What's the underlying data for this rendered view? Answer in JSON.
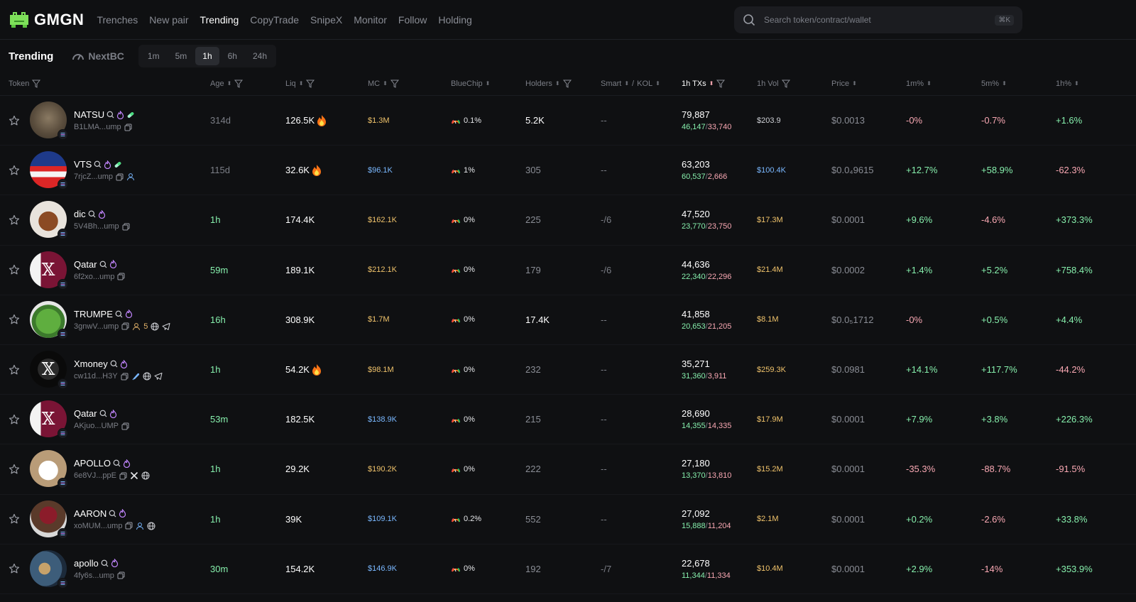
{
  "app": {
    "logo_text": "GMGN"
  },
  "nav": [
    "Trenches",
    "New pair",
    "Trending",
    "CopyTrade",
    "SnipeX",
    "Monitor",
    "Follow",
    "Holding"
  ],
  "nav_active": "Trending",
  "search": {
    "placeholder": "Search token/contract/wallet",
    "shortcut": "⌘K"
  },
  "subbar": {
    "title": "Trending",
    "nextbc": "NextBC",
    "timeframes": [
      "1m",
      "5m",
      "1h",
      "6h",
      "24h"
    ],
    "active_timeframe": "1h"
  },
  "columns": {
    "token": "Token",
    "age": "Age",
    "liq": "Liq",
    "mc": "MC",
    "bluechip": "BlueChip",
    "holders": "Holders",
    "smart": "Smart",
    "kol": "KOL",
    "txs": "1h TXs",
    "vol": "1h Vol",
    "price": "Price",
    "p1m": "1m%",
    "p5m": "5m%",
    "p1h": "1h%"
  },
  "colors": {
    "positive": "#86efac",
    "negative": "#f9a8b3",
    "accent_orange": "#f0c36b",
    "accent_blue": "#7ab8ff"
  },
  "rows": [
    {
      "name": "NATSU",
      "addr": "B1LMA...ump",
      "age": "314d",
      "liq": "126.5K",
      "mc": "$1.3M",
      "bluechip": "0.1%",
      "holders": "5.2K",
      "smart": "--",
      "txs": "79,887",
      "buys": "46,147",
      "sells": "33,740",
      "vol": "$203.9",
      "price": "$0.0013",
      "p1m": "-0%",
      "p5m": "-0.7%",
      "p1h": "+1.6%"
    },
    {
      "name": "VTS",
      "addr": "7rjcZ...ump",
      "age": "115d",
      "liq": "32.6K",
      "mc": "$96.1K",
      "bluechip": "1%",
      "holders": "305",
      "smart": "--",
      "txs": "63,203",
      "buys": "60,537",
      "sells": "2,666",
      "vol": "$100.4K",
      "price": "$0.0₄9615",
      "p1m": "+12.7%",
      "p5m": "+58.9%",
      "p1h": "-62.3%"
    },
    {
      "name": "dic",
      "addr": "5V4Bh...ump",
      "age": "1h",
      "liq": "174.4K",
      "mc": "$162.1K",
      "bluechip": "0%",
      "holders": "225",
      "smart": "-/6",
      "txs": "47,520",
      "buys": "23,770",
      "sells": "23,750",
      "vol": "$17.3M",
      "price": "$0.0001",
      "p1m": "+9.6%",
      "p5m": "-4.6%",
      "p1h": "+373.3%"
    },
    {
      "name": "Qatar",
      "addr": "6f2xo...ump",
      "age": "59m",
      "liq": "189.1K",
      "mc": "$212.1K",
      "bluechip": "0%",
      "holders": "179",
      "smart": "-/6",
      "txs": "44,636",
      "buys": "22,340",
      "sells": "22,296",
      "vol": "$21.4M",
      "price": "$0.0002",
      "p1m": "+1.4%",
      "p5m": "+5.2%",
      "p1h": "+758.4%"
    },
    {
      "name": "TRUMPE",
      "addr": "3gnwV...ump",
      "extra": "5",
      "age": "16h",
      "liq": "308.9K",
      "mc": "$1.7M",
      "bluechip": "0%",
      "holders": "17.4K",
      "smart": "--",
      "txs": "41,858",
      "buys": "20,653",
      "sells": "21,205",
      "vol": "$8.1M",
      "price": "$0.0₅1712",
      "p1m": "-0%",
      "p5m": "+0.5%",
      "p1h": "+4.4%"
    },
    {
      "name": "Xmoney",
      "addr": "cw11d...H3Y",
      "age": "1h",
      "liq": "54.2K",
      "mc": "$98.1M",
      "bluechip": "0%",
      "holders": "232",
      "smart": "--",
      "txs": "35,271",
      "buys": "31,360",
      "sells": "3,911",
      "vol": "$259.3K",
      "price": "$0.0981",
      "p1m": "+14.1%",
      "p5m": "+117.7%",
      "p1h": "-44.2%"
    },
    {
      "name": "Qatar",
      "addr": "AKjuo...UMP",
      "age": "53m",
      "liq": "182.5K",
      "mc": "$138.9K",
      "bluechip": "0%",
      "holders": "215",
      "smart": "--",
      "txs": "28,690",
      "buys": "14,355",
      "sells": "14,335",
      "vol": "$17.9M",
      "price": "$0.0001",
      "p1m": "+7.9%",
      "p5m": "+3.8%",
      "p1h": "+226.3%"
    },
    {
      "name": "APOLLO",
      "addr": "6e8VJ...ppE",
      "age": "1h",
      "liq": "29.2K",
      "mc": "$190.2K",
      "bluechip": "0%",
      "holders": "222",
      "smart": "--",
      "txs": "27,180",
      "buys": "13,370",
      "sells": "13,810",
      "vol": "$15.2M",
      "price": "$0.0001",
      "p1m": "-35.3%",
      "p5m": "-88.7%",
      "p1h": "-91.5%"
    },
    {
      "name": "AARON",
      "addr": "xoMUM...ump",
      "age": "1h",
      "liq": "39K",
      "mc": "$109.1K",
      "bluechip": "0.2%",
      "holders": "552",
      "smart": "--",
      "txs": "27,092",
      "buys": "15,888",
      "sells": "11,204",
      "vol": "$2.1M",
      "price": "$0.0001",
      "p1m": "+0.2%",
      "p5m": "-2.6%",
      "p1h": "+33.8%"
    },
    {
      "name": "apollo",
      "addr": "4fy6s...ump",
      "age": "30m",
      "liq": "154.2K",
      "mc": "$146.9K",
      "bluechip": "0%",
      "holders": "192",
      "smart": "-/7",
      "txs": "22,678",
      "buys": "11,344",
      "sells": "11,334",
      "vol": "$10.4M",
      "price": "$0.0001",
      "p1m": "+2.9%",
      "p5m": "-14%",
      "p1h": "+353.9%"
    }
  ]
}
